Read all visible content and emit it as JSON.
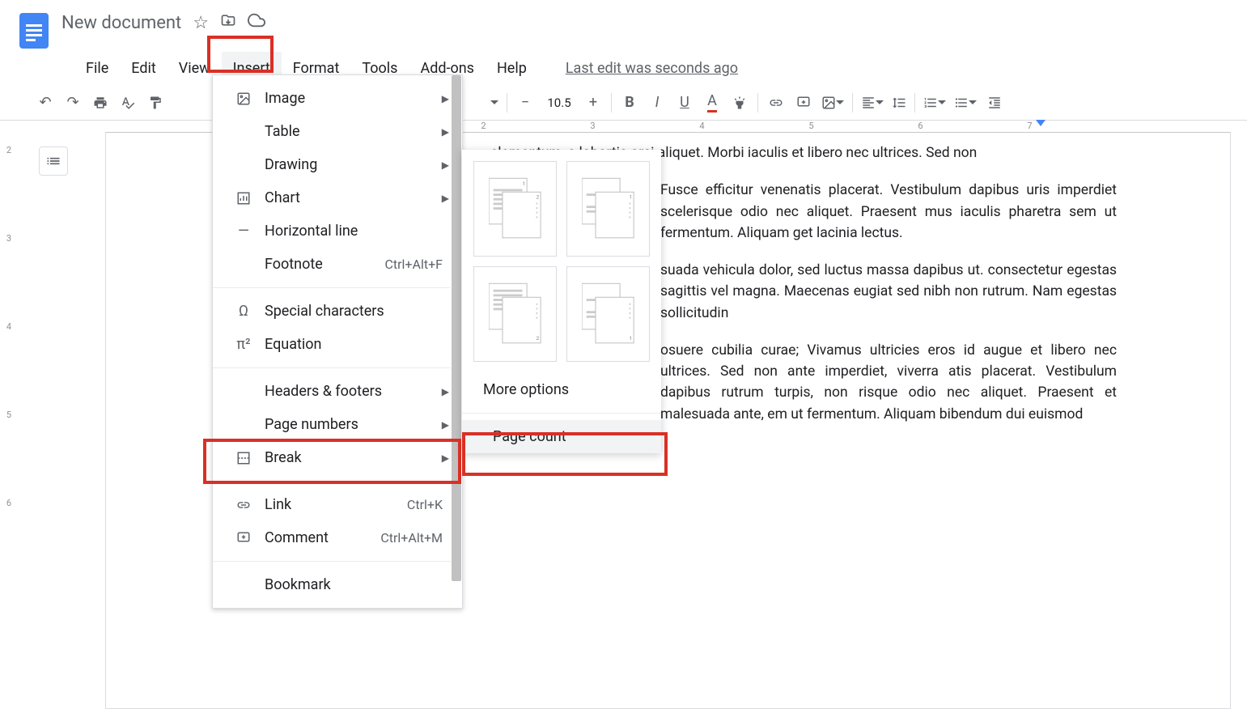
{
  "header": {
    "title": "New document",
    "last_edit": "Last edit was seconds ago"
  },
  "menubar": [
    "File",
    "Edit",
    "View",
    "Insert",
    "Format",
    "Tools",
    "Add-ons",
    "Help"
  ],
  "toolbar": {
    "font_size": "10.5"
  },
  "insert_menu": {
    "image": "Image",
    "table": "Table",
    "drawing": "Drawing",
    "chart": "Chart",
    "horizontal_line": "Horizontal line",
    "footnote": "Footnote",
    "footnote_shortcut": "Ctrl+Alt+F",
    "special_chars": "Special characters",
    "equation": "Equation",
    "headers_footers": "Headers & footers",
    "page_numbers": "Page numbers",
    "break": "Break",
    "link": "Link",
    "link_shortcut": "Ctrl+K",
    "comment": "Comment",
    "comment_shortcut": "Ctrl+Alt+M",
    "bookmark": "Bookmark"
  },
  "submenu": {
    "more_options": "More options",
    "page_count": "Page count"
  },
  "vruler": [
    "2",
    "3",
    "4",
    "5",
    "6"
  ],
  "hruler": [
    "2",
    "3",
    "4",
    "5",
    "6",
    "7"
  ],
  "doc_text": {
    "p1": "elementum, a lobortis orci aliquet. Morbi iaculis et libero nec ultrices. Sed non",
    "p2": "Fusce efficitur venenatis placerat. Vestibulum dapibus uris imperdiet scelerisque odio nec aliquet. Praesent mus iaculis pharetra sem ut fermentum. Aliquam get lacinia lectus.",
    "p3": "suada vehicula dolor, sed luctus massa dapibus ut. consectetur egestas sagittis vel magna. Maecenas eugiat sed nibh non rutrum. Nam egestas sollicitudin",
    "p4": "osuere cubilia curae; Vivamus ultricies eros id augue et libero nec ultrices. Sed non ante imperdiet, viverra atis placerat. Vestibulum dapibus rutrum turpis, non risque odio nec aliquet. Praesent et malesuada ante, em ut fermentum. Aliquam bibendum dui euismod"
  }
}
